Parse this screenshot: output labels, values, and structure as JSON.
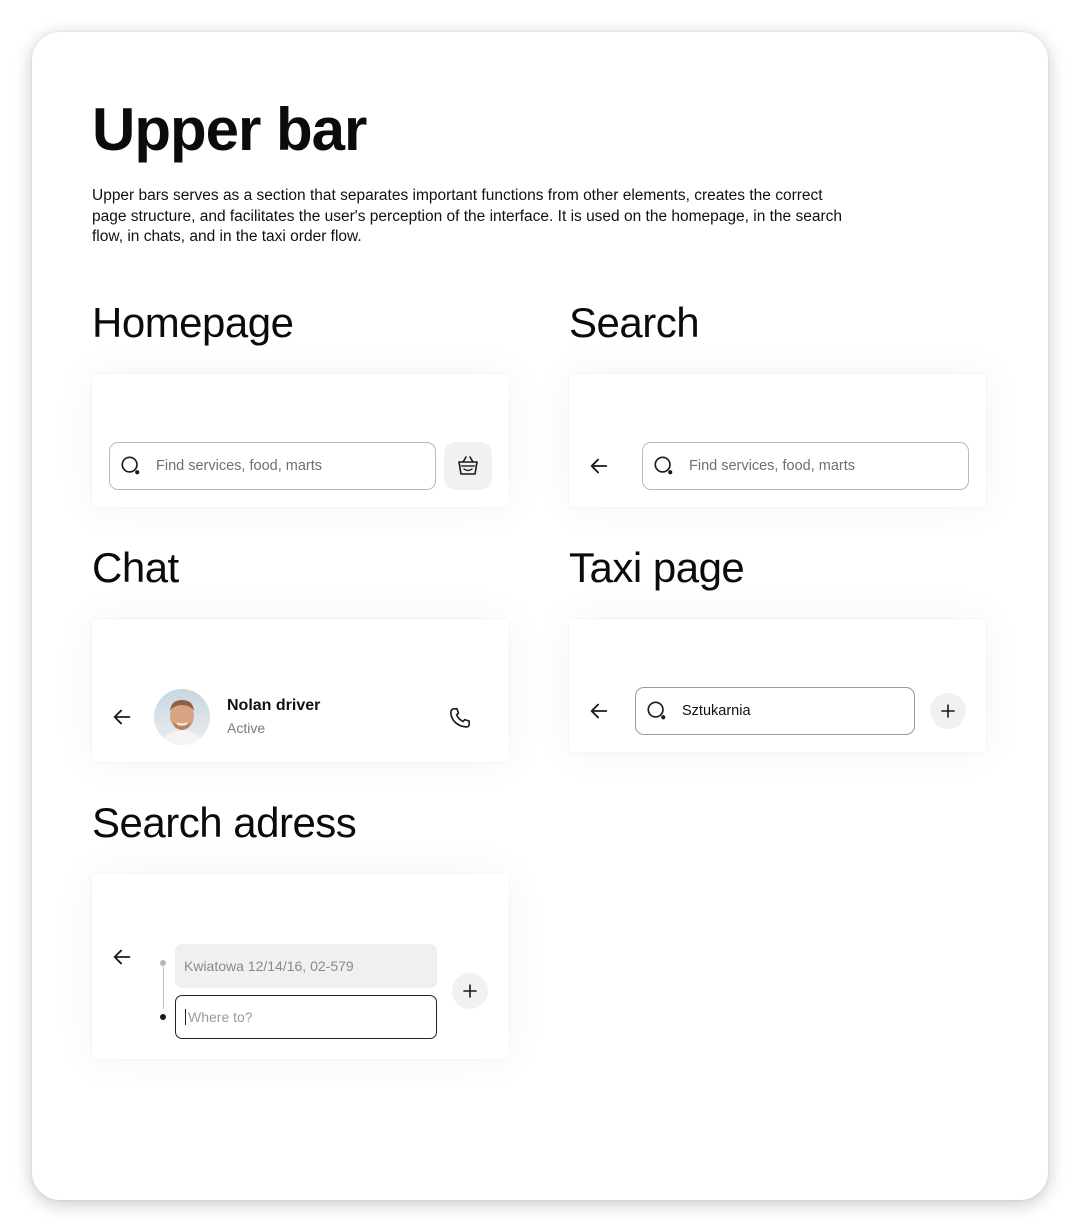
{
  "header": {
    "title": "Upper bar",
    "description": "Upper bars serves as a section that separates important functions from other elements, creates the correct page structure, and facilitates the user's perception of the interface. It is used on the homepage, in the search flow, in chats, and in the taxi order flow."
  },
  "sections": {
    "homepage": {
      "title": "Homepage",
      "search_placeholder": "Find services, food, marts",
      "basket_icon": "basket-icon"
    },
    "search": {
      "title": "Search",
      "search_placeholder": "Find services, food, marts",
      "back_icon": "arrow-left-icon"
    },
    "chat": {
      "title": "Chat",
      "contact_name": "Nolan driver",
      "contact_status": "Active",
      "call_icon": "phone-icon"
    },
    "taxi": {
      "title": "Taxi page",
      "search_value": "Sztukarnia",
      "add_icon": "plus-icon"
    },
    "search_address": {
      "title": "Search adress",
      "from_value": "Kwiatowa 12/14/16, 02-579",
      "to_placeholder": "Where to?",
      "add_icon": "plus-icon"
    }
  },
  "colors": {
    "text": "#111111",
    "muted": "#6f6f6f",
    "field_border": "#b9b9b9",
    "button_bg": "#f1f1f1"
  }
}
